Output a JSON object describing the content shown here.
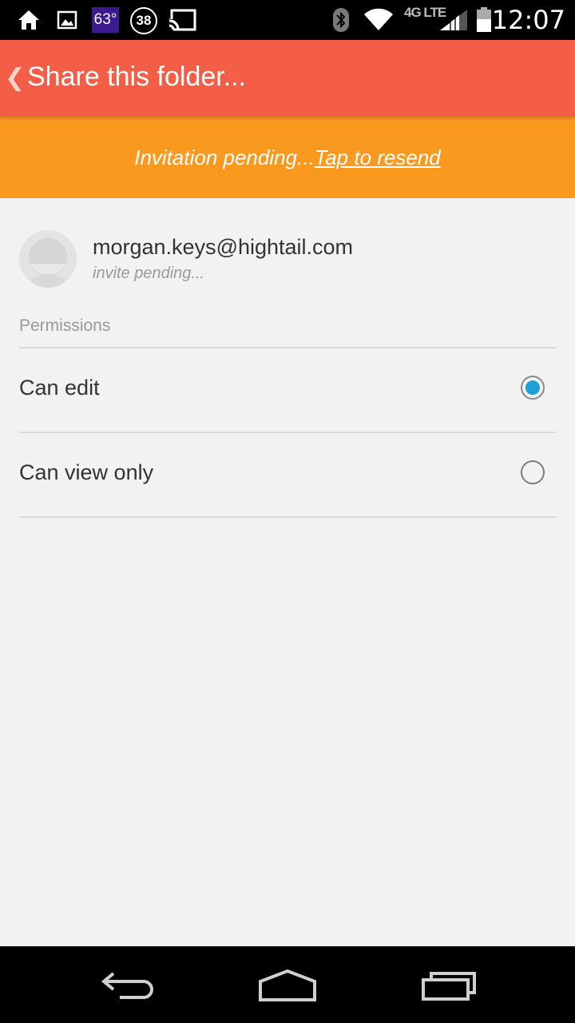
{
  "status_bar": {
    "weather": "63°",
    "notification_count": "38",
    "network": "4G LTE",
    "clock": "12:07",
    "icons": [
      "home-icon",
      "gallery-icon",
      "cast-icon",
      "bluetooth-icon",
      "wifi-icon",
      "signal-icon",
      "battery-icon"
    ]
  },
  "app_bar": {
    "back_glyph": "❮",
    "title": "Share this folder..."
  },
  "banner": {
    "text": "Invitation pending...",
    "link": "Tap to resend",
    "color": "#f99a1f"
  },
  "contact": {
    "email": "morgan.keys@hightail.com",
    "status": "invite pending..."
  },
  "permissions": {
    "label": "Permissions",
    "options": [
      {
        "label": "Can edit",
        "selected": true
      },
      {
        "label": "Can view only",
        "selected": false
      }
    ]
  },
  "colors": {
    "app_bar": "#f45e46",
    "banner": "#f99a1f",
    "radio_selected": "#1e9fd8",
    "background": "#f2f2f2"
  },
  "nav_bar": {
    "icons": [
      "back-icon",
      "home-icon",
      "recent-apps-icon"
    ]
  }
}
